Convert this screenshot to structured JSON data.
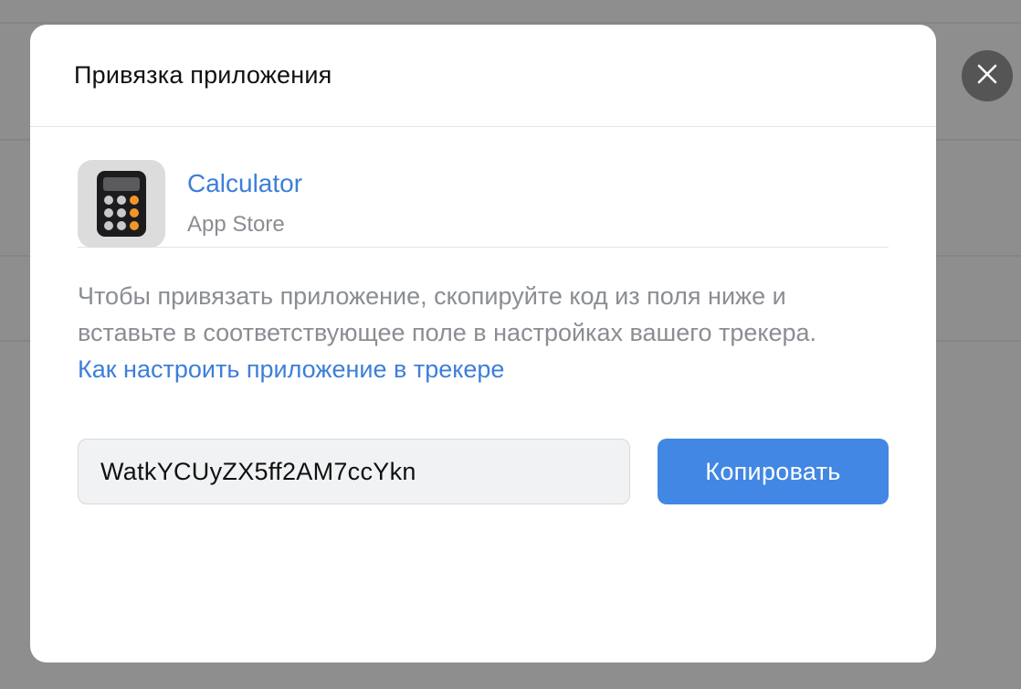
{
  "modal": {
    "title": "Привязка приложения",
    "close_icon": "close-icon"
  },
  "app": {
    "name": "Calculator",
    "source": "App Store",
    "icon": "calculator-icon"
  },
  "instructions": {
    "text": "Чтобы привязать приложение, скопируйте код из поля ниже и вставьте в соответствующее поле в настройках вашего трекера.",
    "link_label": "Как настроить приложение в трекере"
  },
  "code": {
    "value": "WatkYCUyZX5ff2AM7ccYkn",
    "copy_label": "Копировать"
  },
  "colors": {
    "accent": "#4187e3",
    "link": "#3d7fd8",
    "muted_text": "#8a8d93",
    "overlay": "#8e8e8e"
  }
}
